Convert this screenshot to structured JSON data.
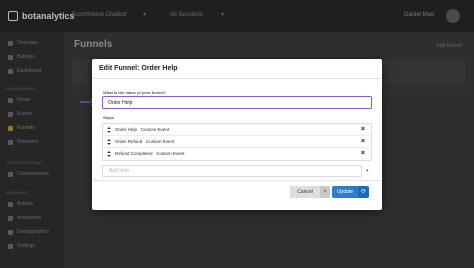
{
  "topbar": {
    "brand": "botanalytics",
    "select_1": "Ecommerce Chatbot",
    "select_2": "All Sessions",
    "user_name": "Daniel Mao"
  },
  "sidebar": {
    "items_top": [
      {
        "label": "Overview",
        "icon": "overview-icon"
      },
      {
        "label": "Bubbles",
        "icon": "bubbles-icon"
      },
      {
        "label": "Dashboard",
        "icon": "dashboard-icon"
      }
    ],
    "section_1": "ENGAGEMENT",
    "items_mid": [
      {
        "label": "Flows",
        "icon": "flows-icon"
      },
      {
        "label": "Events",
        "icon": "events-icon"
      },
      {
        "label": "Funnels",
        "icon": "funnels-icon",
        "active": true
      },
      {
        "label": "Retention",
        "icon": "retention-icon"
      }
    ],
    "section_2": "CONVERSATIONS",
    "items_conv": [
      {
        "label": "Conversations",
        "icon": "conversations-icon"
      }
    ],
    "section_3": "AUDIENCE",
    "items_aud": [
      {
        "label": "Actives",
        "icon": "actives-icon"
      },
      {
        "label": "Acquisition",
        "icon": "acquisition-icon"
      },
      {
        "label": "Demographics",
        "icon": "demographics-icon"
      },
      {
        "label": "Settings",
        "icon": "settings-icon"
      }
    ]
  },
  "main": {
    "title": "Funnels",
    "add_link": "Add Funnel"
  },
  "modal": {
    "title": "Edit Funnel: Order Help",
    "name_label": "What is the name of your funnel?",
    "name_value": "Order Help",
    "steps_label": "Steps",
    "steps": [
      {
        "label": "Order Help   Custom Event"
      },
      {
        "label": "Order Refund   Custom Event"
      },
      {
        "label": "Refund Completed   Custom Event"
      }
    ],
    "add_placeholder": "Add Item",
    "cancel_label": "Cancel",
    "update_label": "Update"
  },
  "colors": {
    "accent_purple": "#8a5cc9",
    "primary_blue": "#2a7dd2"
  }
}
